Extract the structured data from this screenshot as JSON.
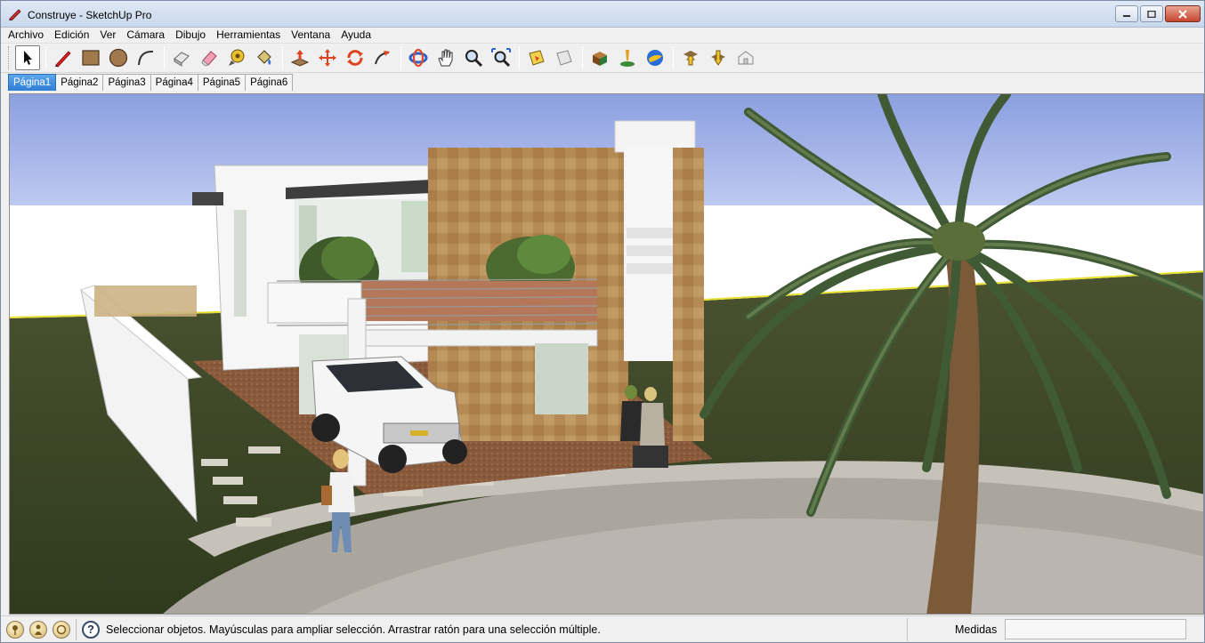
{
  "window": {
    "title": "Construye - SketchUp Pro",
    "controls": [
      "minimize-icon",
      "maximize-icon",
      "close-icon"
    ]
  },
  "menu": {
    "items": [
      "Archivo",
      "Edición",
      "Ver",
      "Cámara",
      "Dibujo",
      "Herramientas",
      "Ventana",
      "Ayuda"
    ]
  },
  "toolbar": {
    "tools": [
      "select-arrow-icon",
      "pencil-line-icon",
      "rectangle-icon",
      "circle-icon",
      "arc-icon",
      "make-component-icon",
      "eraser-icon",
      "tape-measure-icon",
      "paint-bucket-icon",
      "push-pull-icon",
      "move-icon",
      "rotate-icon",
      "follow-me-icon",
      "orbit-icon",
      "pan-hand-icon",
      "zoom-icon",
      "zoom-extents-icon",
      "section-plane-icon",
      "section-display-icon",
      "component-warehouse-icon",
      "add-location-icon",
      "google-earth-icon",
      "get-models-icon",
      "share-model-icon",
      "share-component-icon"
    ]
  },
  "scenes": {
    "tabs": [
      "Página1",
      "Página2",
      "Página3",
      "Página4",
      "Página5",
      "Página6"
    ],
    "active_index": 0
  },
  "status": {
    "hint": "Seleccionar objetos. Mayúsculas para ampliar selección. Arrastrar ratón para una selección múltiple.",
    "measurements_label": "Medidas",
    "measurements_value": ""
  },
  "colors": {
    "sky_top": "#8ea0de",
    "sky_bottom": "#ffffff",
    "grass": "#3f4a26",
    "stone_column": "#b58a54",
    "pavement": "#a8a49c",
    "active_tab": "#3a8ae0"
  }
}
